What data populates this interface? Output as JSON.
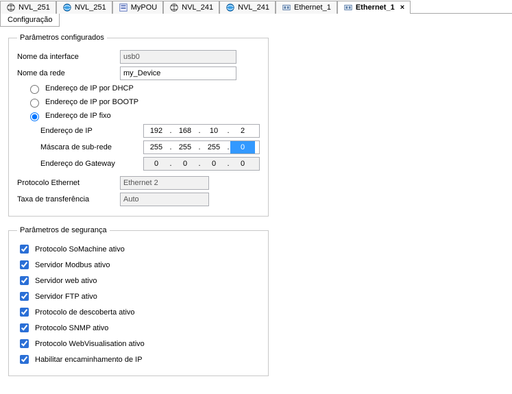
{
  "tabs": [
    {
      "label": "NVL_251",
      "icon": "gvl"
    },
    {
      "label": "NVL_251",
      "icon": "globe"
    },
    {
      "label": "MyPOU",
      "icon": "pou"
    },
    {
      "label": "NVL_241",
      "icon": "gvl"
    },
    {
      "label": "NVL_241",
      "icon": "globe"
    },
    {
      "label": "Ethernet_1",
      "icon": "device"
    },
    {
      "label": "Ethernet_1",
      "icon": "device",
      "active": true,
      "closable": true
    }
  ],
  "subtab": "Configuração",
  "close_glyph": "×",
  "config": {
    "legend": "Parâmetros configurados",
    "interfaceLabel": "Nome da interface",
    "interfaceValue": "usb0",
    "networkLabel": "Nome da rede",
    "networkValue": "my_Device",
    "radio_dhcp": "Endereço de IP por DHCP",
    "radio_bootp": "Endereço de IP por BOOTP",
    "radio_fixed": "Endereço de IP fixo",
    "ipLabel": "Endereço de IP",
    "ip": [
      "192",
      "168",
      "10",
      "2"
    ],
    "maskLabel": "Máscara de sub-rede",
    "mask": [
      "255",
      "255",
      "255",
      "0"
    ],
    "gwLabel": "Endereço do Gateway",
    "gw": [
      "0",
      "0",
      "0",
      "0"
    ],
    "ethProtoLabel": "Protocolo Ethernet",
    "ethProtoValue": "Ethernet 2",
    "rateLabel": "Taxa de transferência",
    "rateValue": "Auto"
  },
  "security": {
    "legend": "Parâmetros de segurança",
    "items": [
      "Protocolo SoMachine ativo",
      "Servidor Modbus ativo",
      "Servidor web ativo",
      "Servidor FTP ativo",
      "Protocolo de descoberta ativo",
      "Protocolo SNMP ativo",
      "Protocolo WebVisualisation ativo",
      "Habilitar encaminhamento de IP"
    ]
  }
}
